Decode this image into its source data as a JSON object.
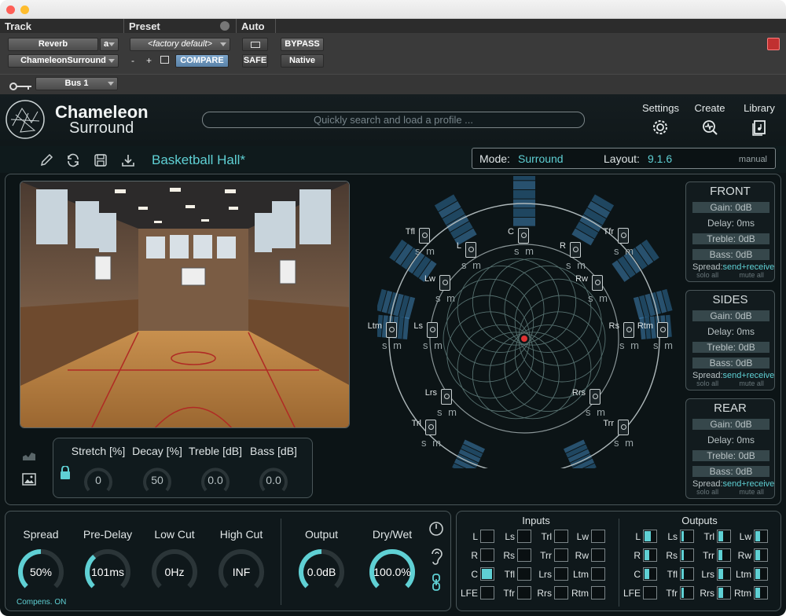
{
  "host": {
    "track_header": "Track",
    "preset_header": "Preset",
    "auto_header": "Auto",
    "track_name": "Reverb",
    "track_channel": "a",
    "plugin_name": "ChameleonSurround",
    "preset_name": "<factory default>",
    "preset_minus": "-",
    "preset_plus": "+",
    "compare": "COMPARE",
    "bypass": "BYPASS",
    "safe": "SAFE",
    "native": "Native",
    "bus": "Bus 1"
  },
  "plugin": {
    "logo_line1": "Chameleon",
    "logo_line2": "Surround",
    "search_placeholder": "Quickly search and load a profile ...",
    "nav": [
      {
        "label": "Settings",
        "icon": "gear-icon"
      },
      {
        "label": "Create",
        "icon": "pulse-icon"
      },
      {
        "label": "Library",
        "icon": "library-icon"
      }
    ],
    "profile_name": "Basketball Hall*",
    "mode_label": "Mode:",
    "mode_value": "Surround",
    "layout_label": "Layout:",
    "layout_value": "9.1.6",
    "layout_mode": "manual",
    "image_knobs": [
      {
        "label": "Stretch [%]",
        "value": "0"
      },
      {
        "label": "Decay [%]",
        "value": "50"
      },
      {
        "label": "Treble [dB]",
        "value": "0.0"
      },
      {
        "label": "Bass [dB]",
        "value": "0.0"
      }
    ],
    "speakers": [
      {
        "name": "Tfl"
      },
      {
        "name": "L"
      },
      {
        "name": "C"
      },
      {
        "name": "R"
      },
      {
        "name": "Tfr"
      },
      {
        "name": "Lw"
      },
      {
        "name": "Rw"
      },
      {
        "name": "Ltm"
      },
      {
        "name": "Ls"
      },
      {
        "name": "Rs"
      },
      {
        "name": "Rtm"
      },
      {
        "name": "Lrs"
      },
      {
        "name": "Rrs"
      },
      {
        "name": "Trl"
      },
      {
        "name": "Trr"
      }
    ],
    "solo_mute": "s m",
    "groups": [
      {
        "title": "FRONT",
        "gain": "Gain: 0dB",
        "delay": "Delay: 0ms",
        "treble": "Treble: 0dB",
        "bass": "Bass: 0dB",
        "spread_label": "Spread:",
        "spread_value": "send+receive",
        "solo_all": "solo all",
        "mute_all": "mute all"
      },
      {
        "title": "SIDES",
        "gain": "Gain: 0dB",
        "delay": "Delay: 0ms",
        "treble": "Treble: 0dB",
        "bass": "Bass: 0dB",
        "spread_label": "Spread:",
        "spread_value": "send+receive",
        "solo_all": "solo all",
        "mute_all": "mute all"
      },
      {
        "title": "REAR",
        "gain": "Gain: 0dB",
        "delay": "Delay: 0ms",
        "treble": "Treble: 0dB",
        "bass": "Bass: 0dB",
        "spread_label": "Spread:",
        "spread_value": "send+receive",
        "solo_all": "solo all",
        "mute_all": "mute all"
      }
    ],
    "bottom_knobs": [
      {
        "label": "Spread",
        "value": "50%",
        "level": 0.5
      },
      {
        "label": "Pre-Delay",
        "value": "101ms",
        "level": 0.35
      },
      {
        "label": "Low Cut",
        "value": "0Hz",
        "level": 0
      },
      {
        "label": "High Cut",
        "value": "INF",
        "level": 0
      },
      {
        "label": "Output",
        "value": "0.0dB",
        "level": 0.5
      },
      {
        "label": "Dry/Wet",
        "value": "100.0%",
        "level": 1
      }
    ],
    "compens": "Compens. ON",
    "inputs_title": "Inputs",
    "outputs_title": "Outputs",
    "io_channels": [
      "L",
      "Ls",
      "Trl",
      "Lw",
      "R",
      "Rs",
      "Trr",
      "Rw",
      "C",
      "Tfl",
      "Lrs",
      "Ltm",
      "LFE",
      "Tfr",
      "Rrs",
      "Rtm"
    ],
    "inputs_level": [
      0,
      0,
      0,
      0,
      0,
      0,
      0,
      0,
      0.8,
      0,
      0,
      0,
      0,
      0,
      0,
      0
    ],
    "outputs_level": [
      0.5,
      0.2,
      0.4,
      0.4,
      0.4,
      0.2,
      0.3,
      0.4,
      0.4,
      0.2,
      0.4,
      0.4,
      0,
      0.2,
      0.4,
      0.4
    ],
    "accent": "#5fd0d4"
  }
}
